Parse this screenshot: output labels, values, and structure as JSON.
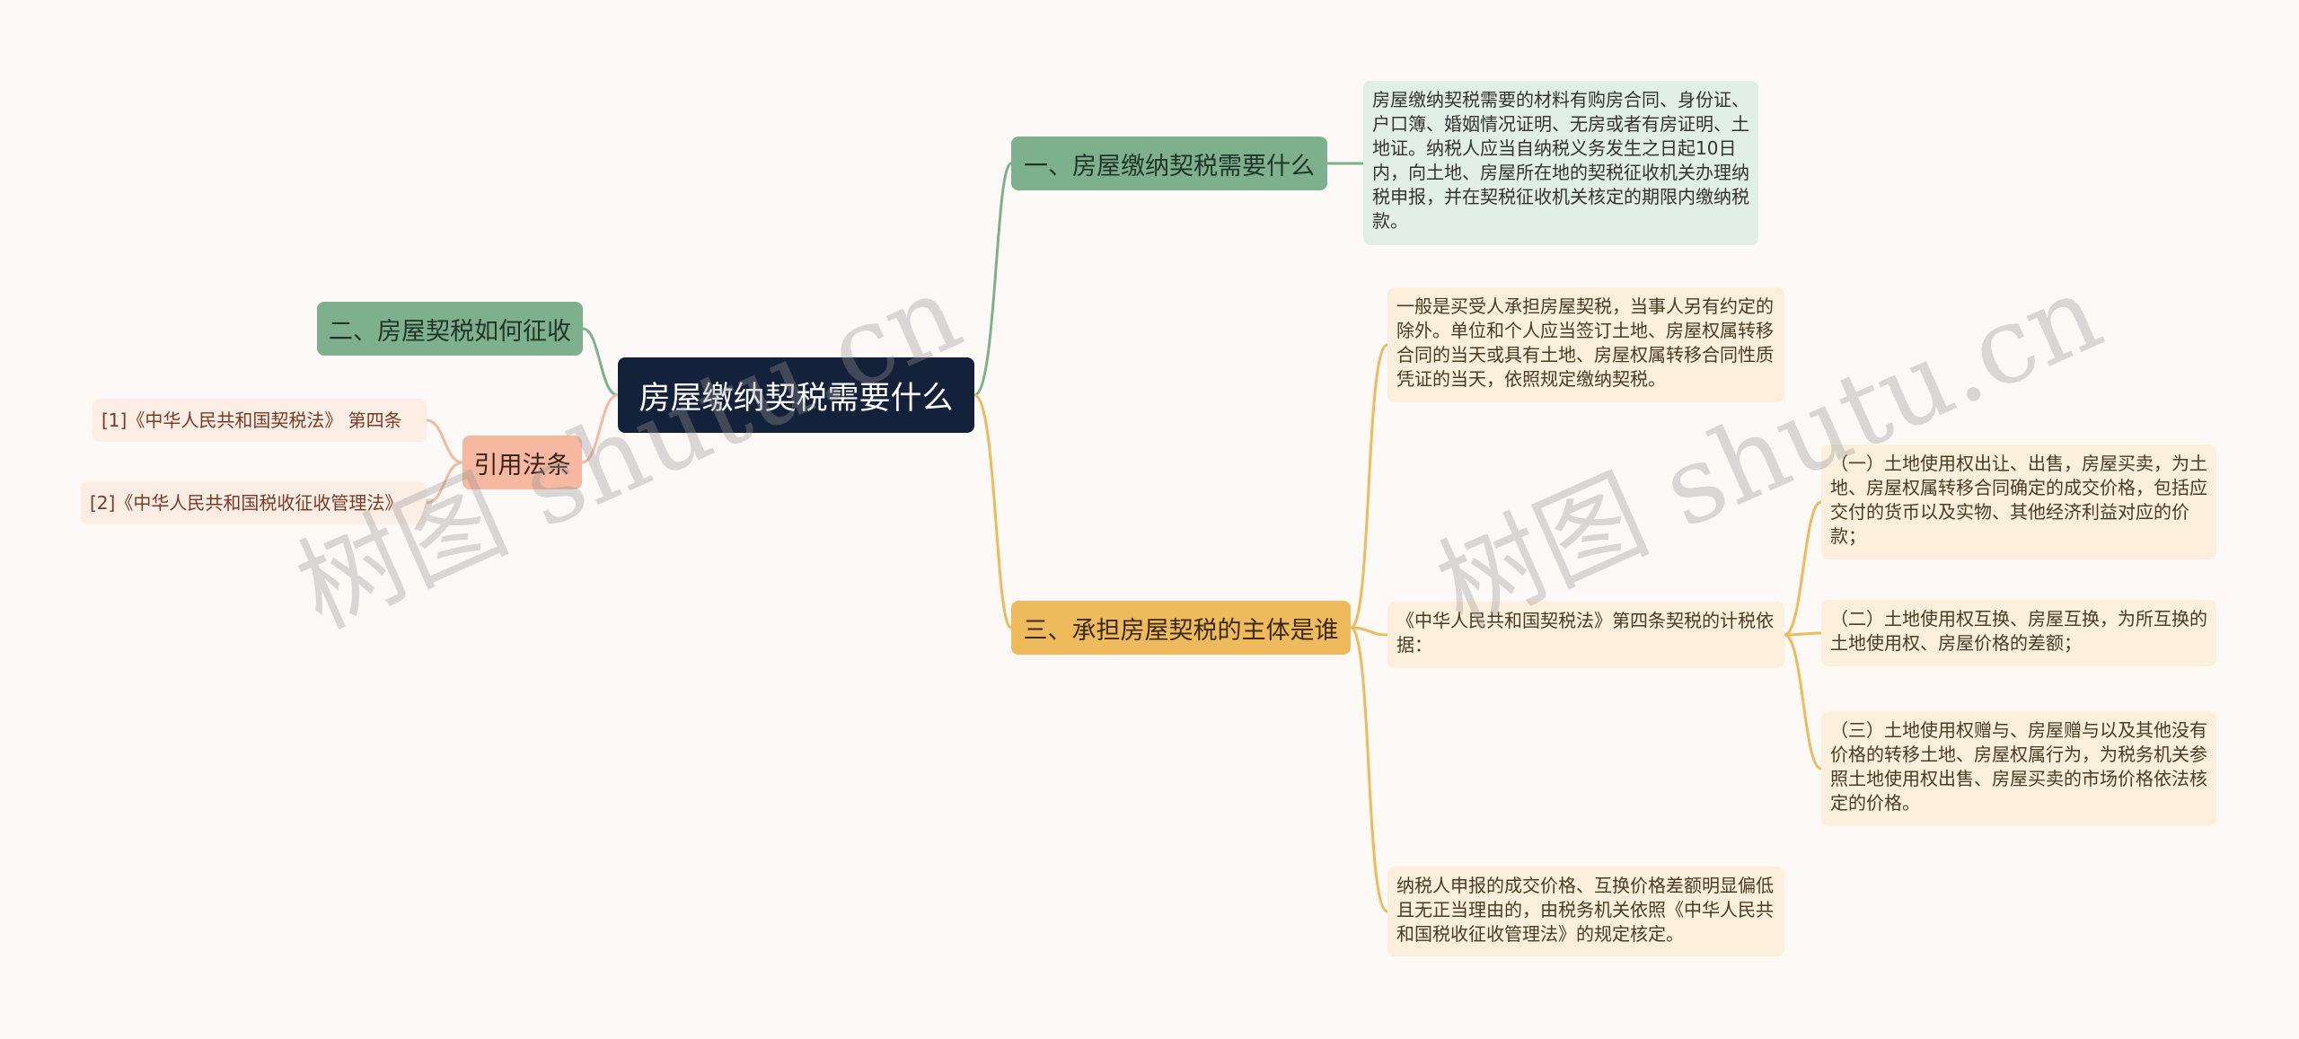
{
  "root": {
    "label": "房屋缴纳契税需要什么"
  },
  "branch1": {
    "label": "一、房屋缴纳契税需要什么",
    "leaf": "房屋缴纳契税需要的材料有购房合同、身份证、户口簿、婚姻情况证明、无房或者有房证明、土地证。纳税人应当自纳税义务发生之日起10日内，向土地、房屋所在地的契税征收机关办理纳税申报，并在契税征收机关核定的期限内缴纳税款。"
  },
  "branch2": {
    "label": "二、房屋契税如何征收"
  },
  "citations": {
    "label": "引用法条",
    "items": [
      "[1]《中华人民共和国契税法》 第四条",
      "[2]《中华人民共和国税收征收管理法》"
    ]
  },
  "branch3": {
    "label": "三、承担房屋契税的主体是谁",
    "leaf_a": "一般是买受人承担房屋契税，当事人另有约定的除外。单位和个人应当签订土地、房屋权属转移合同的当天或具有土地、房屋权属转移合同性质凭证的当天，依照规定缴纳契税。",
    "leaf_b": "《中华人民共和国契税法》第四条契税的计税依据：",
    "leaf_b_children": [
      "（一）土地使用权出让、出售，房屋买卖，为土地、房屋权属转移合同确定的成交价格，包括应交付的货币以及实物、其他经济利益对应的价款；",
      "（二）土地使用权互换、房屋互换，为所互换的土地使用权、房屋价格的差额；",
      "（三）土地使用权赠与、房屋赠与以及其他没有价格的转移土地、房屋权属行为，为税务机关参照土地使用权出售、房屋买卖的市场价格依法核定的价格。"
    ],
    "leaf_c": "纳税人申报的成交价格、互换价格差额明显偏低且无正当理由的，由税务机关依照《中华人民共和国税收征收管理法》的规定核定。"
  },
  "watermark": "树图 shutu.cn",
  "colors": {
    "root": "#14213a",
    "green": "#7fb08d",
    "yellow": "#eeba5c",
    "salmon": "#f6b8a0",
    "background": "#fdf9f7"
  }
}
